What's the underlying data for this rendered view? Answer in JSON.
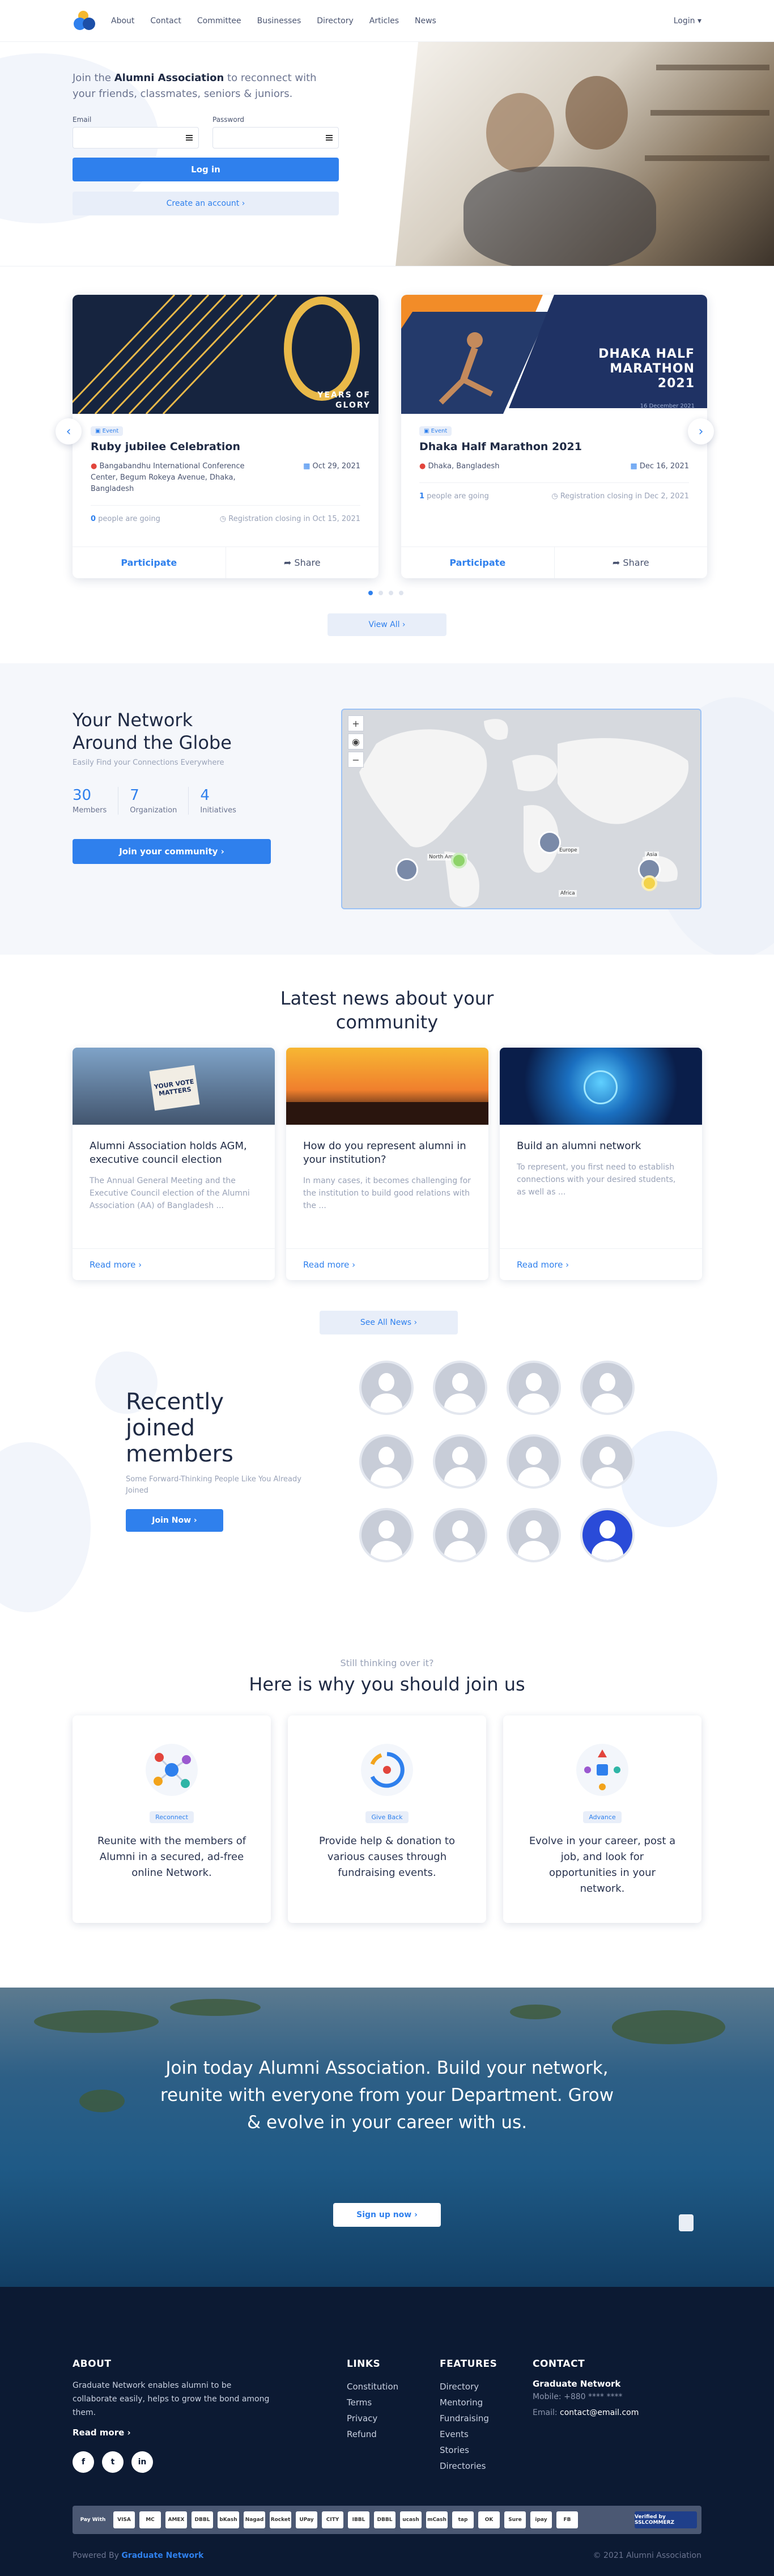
{
  "nav": {
    "links": [
      "About",
      "Contact",
      "Committee",
      "Businesses",
      "Directory",
      "Articles",
      "News"
    ],
    "login": "Login ▾"
  },
  "hero": {
    "intro_pre": "Join the ",
    "intro_bold": "Alumni Association",
    "intro_post": " to reconnect with your friends, classmates, seniors & juniors.",
    "email_label": "Email",
    "password_label": "Password",
    "login_button": "Log in",
    "create_button": "Create an account ›"
  },
  "events": {
    "items": [
      {
        "badge": "Event",
        "image_text_line1": "YEARS OF",
        "image_text_line2": "GLORY",
        "title": "Ruby jubilee Celebration",
        "location": "Bangabandhu International Conference Center, Begum Rokeya Avenue, Dhaka, Bangladesh",
        "date": "Oct 29, 2021",
        "going_count": "0",
        "going_text": " people are going",
        "closing": "Registration closing in Oct 15, 2021",
        "participate": "Participate",
        "share": "Share"
      },
      {
        "badge": "Event",
        "image_text_line1": "DHAKA HALF",
        "image_text_line2": "MARATHON",
        "image_text_line3": "2021",
        "image_date": "16 December 2021",
        "title": "Dhaka Half Marathon 2021",
        "location": "Dhaka, Bangladesh",
        "date": "Dec 16, 2021",
        "going_count": "1",
        "going_text": " people are going",
        "closing": "Registration closing in Dec 2, 2021",
        "participate": "Participate",
        "share": "Share"
      }
    ],
    "view_all": "View All ›"
  },
  "network": {
    "title": "Your Network\nAround the Globe",
    "subtitle": "Easily Find your Connections Everywhere",
    "stats": [
      {
        "value": "30",
        "label": "Members"
      },
      {
        "value": "7",
        "label": "Organization"
      },
      {
        "value": "4",
        "label": "Initiatives"
      }
    ],
    "join_button": "Join your community ›",
    "map_labels": [
      "North America",
      "Europe",
      "Asia",
      "Africa"
    ]
  },
  "news": {
    "title": "Latest news about your\ncommunity",
    "items": [
      {
        "title": "Alumni Association holds AGM, executive council election",
        "excerpt": "The Annual General Meeting and the Executive Council election of the Alumni Association (AA) of Bangladesh ...",
        "read_more": "Read more ›",
        "image_text": "YOUR VOTE MATTERS"
      },
      {
        "title": "How do you represent alumni in your institution?",
        "excerpt": "In many cases, it becomes challenging for the institution to build good relations with the ...",
        "read_more": "Read more ›"
      },
      {
        "title": "Build an alumni network",
        "excerpt": "To represent, you first need to establish connections with your desired students, as well as ...",
        "read_more": "Read more ›"
      }
    ],
    "see_all": "See All News ›"
  },
  "members": {
    "title": "Recently\njoined\nmembers",
    "subtitle": "Some Forward-Thinking People Like You Already Joined",
    "join_button": "Join Now ›"
  },
  "why": {
    "kicker": "Still thinking over it?",
    "title": "Here is why you should join us",
    "cards": [
      {
        "tag": "Reconnect",
        "text": "Reunite with the members of Alumni in a secured, ad-free online Network."
      },
      {
        "tag": "Give Back",
        "text": "Provide help & donation to various causes through fundraising events."
      },
      {
        "tag": "Advance",
        "text": "Evolve in your career, post a job, and look for opportunities in your network."
      }
    ]
  },
  "cta": {
    "text": "Join today Alumni Association. Build your network, reunite with everyone from your Department. Grow & evolve in your career with us.",
    "button": "Sign up now ›"
  },
  "footer": {
    "about_title": "ABOUT",
    "about_text": "Graduate Network enables alumni to be collaborate easily, helps to grow the bond among them.",
    "read_more": "Read more ›",
    "links_title": "LINKS",
    "links": [
      "Constitution",
      "Terms",
      "Privacy",
      "Refund"
    ],
    "features_title": "FEATURES",
    "features": [
      "Directory",
      "Mentoring",
      "Fundraising",
      "Events",
      "Stories",
      "Directories"
    ],
    "contact_title": "CONTACT",
    "org": "Graduate Network",
    "mobile_label": "Mobile: ",
    "mobile": "+880 **** ****",
    "email_label": "Email: ",
    "email": "contact@email.com",
    "social": [
      "f",
      "t",
      "in"
    ],
    "pay_label": "Pay With",
    "payments": [
      "VISA",
      "MC",
      "AMEX",
      "DBBL",
      "bKash",
      "Nagad",
      "Rocket",
      "UPay",
      "CITY",
      "IBBL",
      "DBBL",
      "ucash",
      "mCash",
      "tap",
      "OK",
      "Sure",
      "ipay",
      "FB"
    ],
    "verified": "Verified by SSLCOMMERZ",
    "powered_pre": "Powered By ",
    "powered_brand": "Graduate Network",
    "copyright": "© 2021 Alumni Association"
  }
}
